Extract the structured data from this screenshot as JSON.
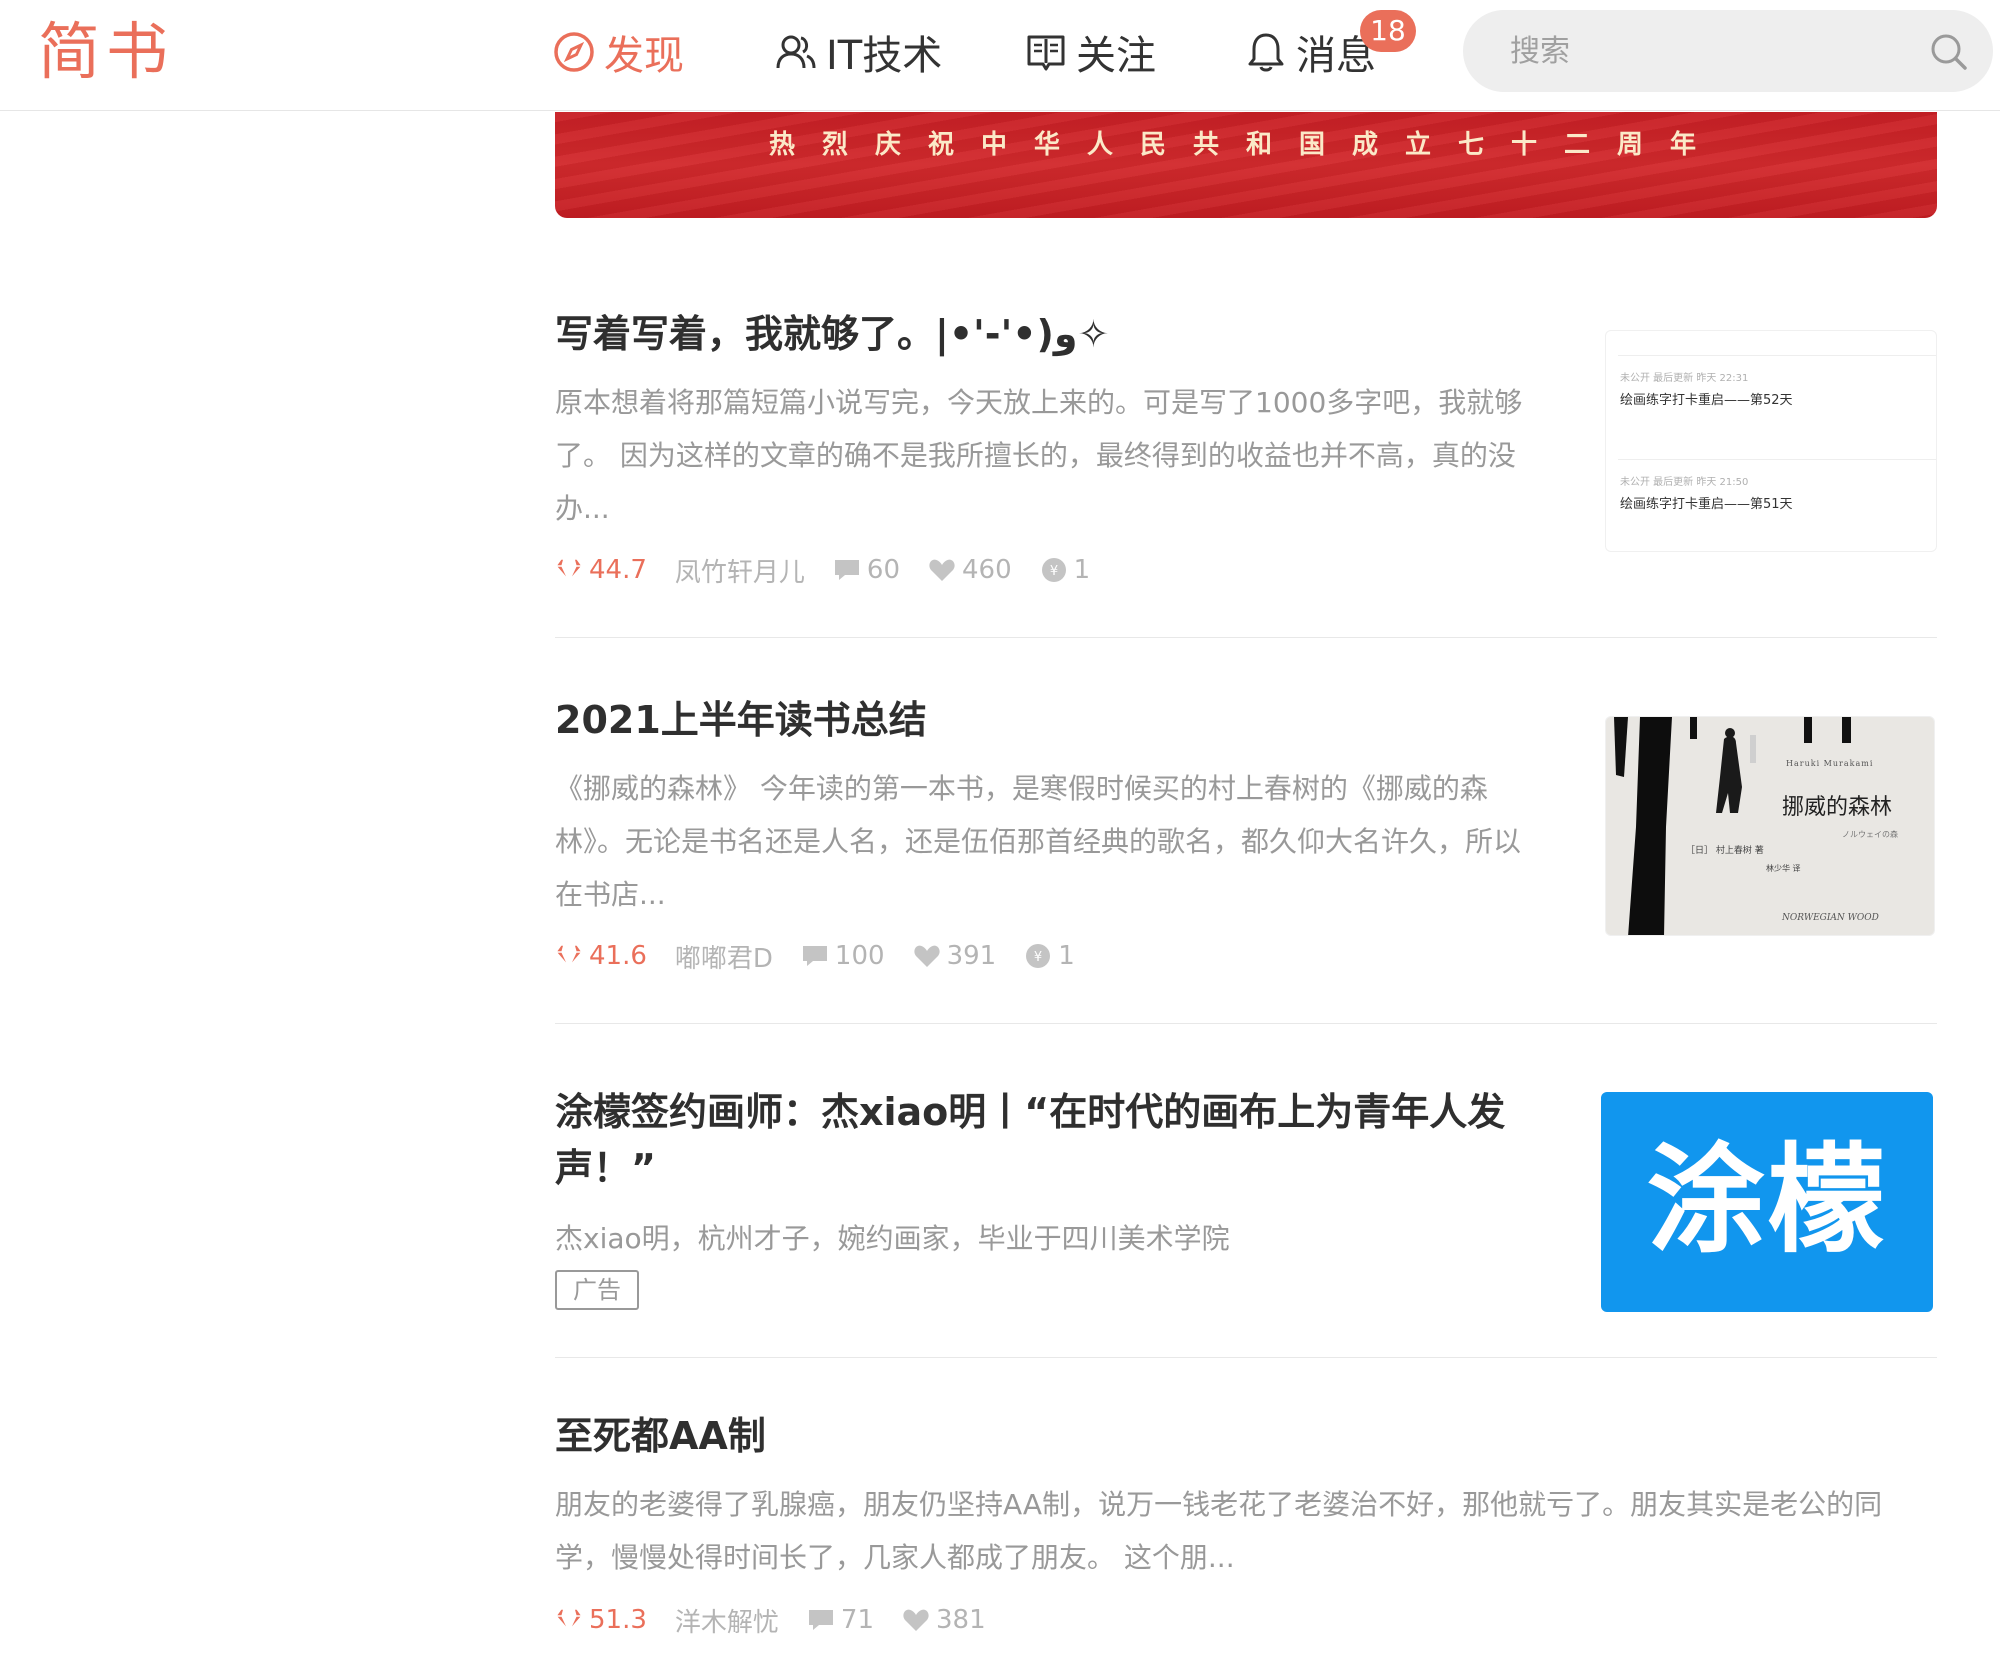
{
  "header": {
    "logo": "简书",
    "nav": [
      {
        "label": "发现"
      },
      {
        "label": "IT技术"
      },
      {
        "label": "关注"
      },
      {
        "label": "消息"
      }
    ],
    "message_badge": "18",
    "search_placeholder": "搜索",
    "accent_color": "#ea6f5a"
  },
  "banner": {
    "text": "热烈庆祝中华人民共和国成立七十二周年"
  },
  "articles": [
    {
      "title": "写着写着，我就够了。|•'-'•)و✧",
      "abstract": [
        "原本想着将那篇短篇小说写完，今天放上来的。可是写了1000多字吧，我就够",
        "了。 因为这样的文章的确不是我所擅长的，最终得到的收益也并不高，真的没",
        "办..."
      ],
      "diamond": "44.7",
      "author": "凤竹轩月儿",
      "comments": "60",
      "likes": "460",
      "rewards": "1",
      "thumb": {
        "rows": [
          {
            "top": "未公开  最后更新  昨天 22:31",
            "title": "绘画练字打卡重启——第52天"
          },
          {
            "top": "未公开  最后更新  昨天 21:50",
            "title": "绘画练字打卡重启——第51天"
          }
        ]
      }
    },
    {
      "title": "2021上半年读书总结",
      "abstract": [
        "《挪威的森林》 今年读的第一本书，是寒假时候买的村上春树的《挪威的森",
        "林》。无论是书名还是人名，还是伍佰那首经典的歌名，都久仰大名许久，所以",
        "在书店..."
      ],
      "diamond": "41.6",
      "author": "嘟嘟君D",
      "comments": "100",
      "likes": "391",
      "rewards": "1",
      "thumb": {
        "cover_author_en": "Haruki Murakami",
        "cover_title": "挪威的森林",
        "cover_sub": "ノルウェイの森",
        "cover_author": "［日］ 村上春树 著",
        "cover_translator": "林少华 译",
        "cover_title_en": "NORWEGIAN WOOD"
      }
    },
    {
      "title_lines": [
        "涂檬签约画师：杰xiao明丨“在时代的画布上为青年人发",
        "声！”"
      ],
      "abstract": [
        "杰xiao明，杭州才子，婉约画家，毕业于四川美术学院"
      ],
      "ad_label": "广告",
      "thumb": {
        "logo_text": "涂檬",
        "color": "#1196ee"
      }
    },
    {
      "title": "至死都AA制",
      "abstract": [
        "朋友的老婆得了乳腺癌，朋友仍坚持AA制，说万一钱老花了老婆治不好，那他就亏了。朋友其实是老公的同",
        "学，慢慢处得时间长了，几家人都成了朋友。 这个朋..."
      ],
      "diamond": "51.3",
      "author": "洋木解忧",
      "comments": "71",
      "likes": "381"
    }
  ]
}
